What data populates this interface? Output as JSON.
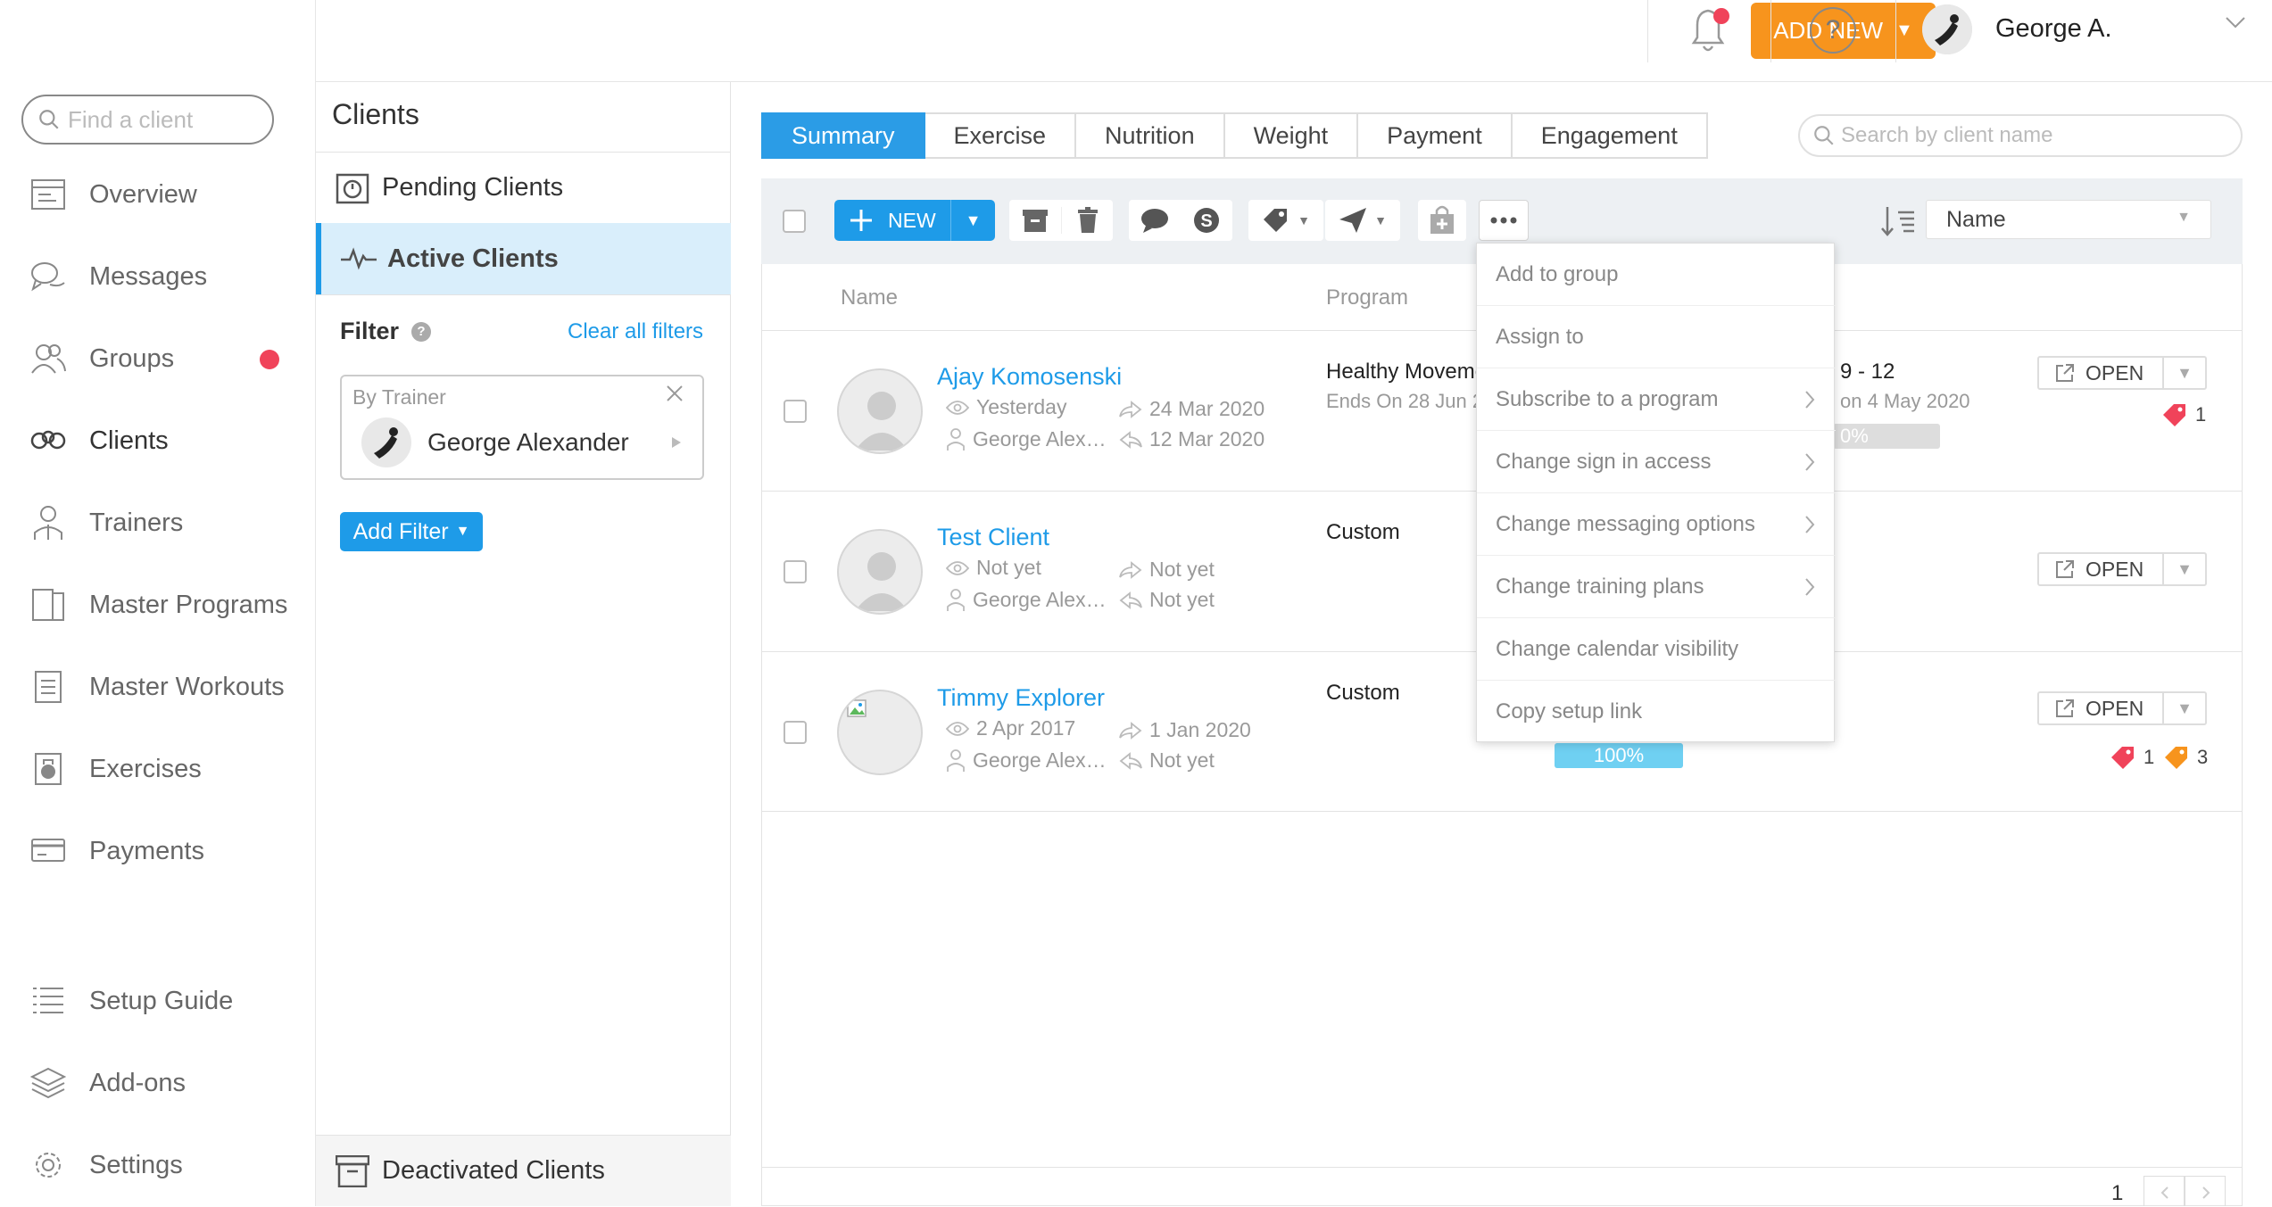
{
  "sidebar": {
    "search_placeholder": "Find a client",
    "items": [
      {
        "label": "Overview",
        "icon": "overview-icon"
      },
      {
        "label": "Messages",
        "icon": "messages-icon"
      },
      {
        "label": "Groups",
        "icon": "groups-icon",
        "notification": true
      },
      {
        "label": "Clients",
        "icon": "clients-icon",
        "active": true
      },
      {
        "label": "Trainers",
        "icon": "trainers-icon"
      },
      {
        "label": "Master Programs",
        "icon": "programs-icon"
      },
      {
        "label": "Master Workouts",
        "icon": "workouts-icon"
      },
      {
        "label": "Exercises",
        "icon": "kettlebell-icon"
      },
      {
        "label": "Payments",
        "icon": "card-icon"
      }
    ],
    "bottom_items": [
      {
        "label": "Setup Guide",
        "icon": "list-icon"
      },
      {
        "label": "Add-ons",
        "icon": "layers-icon"
      },
      {
        "label": "Settings",
        "icon": "gear-icon"
      }
    ]
  },
  "header": {
    "add_new_label": "ADD NEW",
    "user_name": "George A.",
    "help_label": "?"
  },
  "clients_panel": {
    "title": "Clients",
    "pending_label": "Pending Clients",
    "active_label": "Active Clients",
    "filter_label": "Filter",
    "clear_filters_label": "Clear all filters",
    "filter_by_trainer_label": "By Trainer",
    "filter_trainer_name": "George Alexander",
    "add_filter_label": "Add Filter",
    "deactivated_label": "Deactivated Clients"
  },
  "tabs": [
    {
      "label": "Summary",
      "selected": true
    },
    {
      "label": "Exercise"
    },
    {
      "label": "Nutrition"
    },
    {
      "label": "Weight"
    },
    {
      "label": "Payment"
    },
    {
      "label": "Engagement"
    }
  ],
  "search_placeholder": "Search by client name",
  "toolbar": {
    "new_label": "NEW",
    "sort_value": "Name"
  },
  "columns": {
    "name": "Name",
    "program": "Program"
  },
  "clients": [
    {
      "name": "Ajay Komosenski",
      "last_seen": "Yesterday",
      "trainer": "George Alex…",
      "last_message": "24 Mar 2020",
      "last_reply": "12 Mar 2020",
      "program": "Healthy Moveme",
      "program_sub": "Ends On 28 Jun 2",
      "extra_top": "9 - 12",
      "extra_sub": "on 4 May 2020",
      "progress_text": "0%",
      "progress": 0,
      "open_label": "OPEN",
      "tag_red": "1"
    },
    {
      "name": "Test Client",
      "last_seen": "Not yet",
      "trainer": "George Alex…",
      "last_message": "Not yet",
      "last_reply": "Not yet",
      "program": "Custom",
      "open_label": "OPEN"
    },
    {
      "name": "Timmy Explorer",
      "last_seen": "2 Apr 2017",
      "trainer": "George Alex…",
      "last_message": "1 Jan 2020",
      "last_reply": "Not yet",
      "program": "Custom",
      "progress_text": "100%",
      "progress": 100,
      "open_label": "OPEN",
      "tag_red": "1",
      "tag_orange": "3"
    }
  ],
  "context_menu": [
    {
      "label": "Add to group",
      "submenu": false
    },
    {
      "label": "Assign to",
      "submenu": false
    },
    {
      "label": "Subscribe to a program",
      "submenu": true
    },
    {
      "label": "Change sign in access",
      "submenu": true
    },
    {
      "label": "Change messaging options",
      "submenu": true
    },
    {
      "label": "Change training plans",
      "submenu": true
    },
    {
      "label": "Change calendar visibility",
      "submenu": false
    },
    {
      "label": "Copy setup link",
      "submenu": false
    }
  ],
  "pagination": {
    "current": "1"
  },
  "colors": {
    "accent": "#1e9be8",
    "orange": "#f7941d",
    "red": "#f0435a"
  }
}
